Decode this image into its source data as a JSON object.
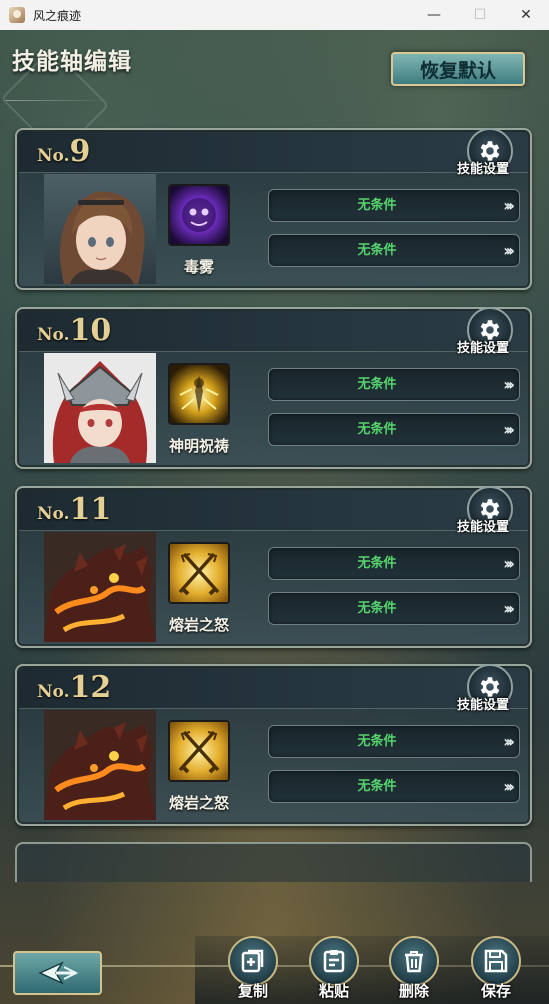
{
  "window": {
    "title": "风之痕迹",
    "minimize": "—",
    "maximize": "☐",
    "close": "✕"
  },
  "header": {
    "title": "技能轴编辑",
    "reset_label": "恢复默认"
  },
  "cards": [
    {
      "no_prefix": "No.",
      "number": "9",
      "settings_label": "技能设置",
      "skill_name": "毒雾",
      "conditions": [
        "无条件",
        "无条件"
      ]
    },
    {
      "no_prefix": "No.",
      "number": "10",
      "settings_label": "技能设置",
      "skill_name": "神明祝祷",
      "conditions": [
        "无条件",
        "无条件"
      ]
    },
    {
      "no_prefix": "No.",
      "number": "11",
      "settings_label": "技能设置",
      "skill_name": "熔岩之怒",
      "conditions": [
        "无条件",
        "无条件"
      ]
    },
    {
      "no_prefix": "No.",
      "number": "12",
      "settings_label": "技能设置",
      "skill_name": "熔岩之怒",
      "conditions": [
        "无条件",
        "无条件"
      ]
    }
  ],
  "arrow_glyph": "›››",
  "toolbar": {
    "copy_label": "复制",
    "paste_label": "粘贴",
    "delete_label": "删除",
    "save_label": "保存"
  },
  "icons": {
    "back": "back-arrow-icon",
    "settings": "gear-icon",
    "copy": "copy-icon",
    "paste": "paste-icon",
    "delete": "trash-icon",
    "save": "save-icon"
  },
  "colors": {
    "condition_text": "#56d36b",
    "number_gold": "#e4cf95",
    "button_teal": "#3f7c80"
  }
}
